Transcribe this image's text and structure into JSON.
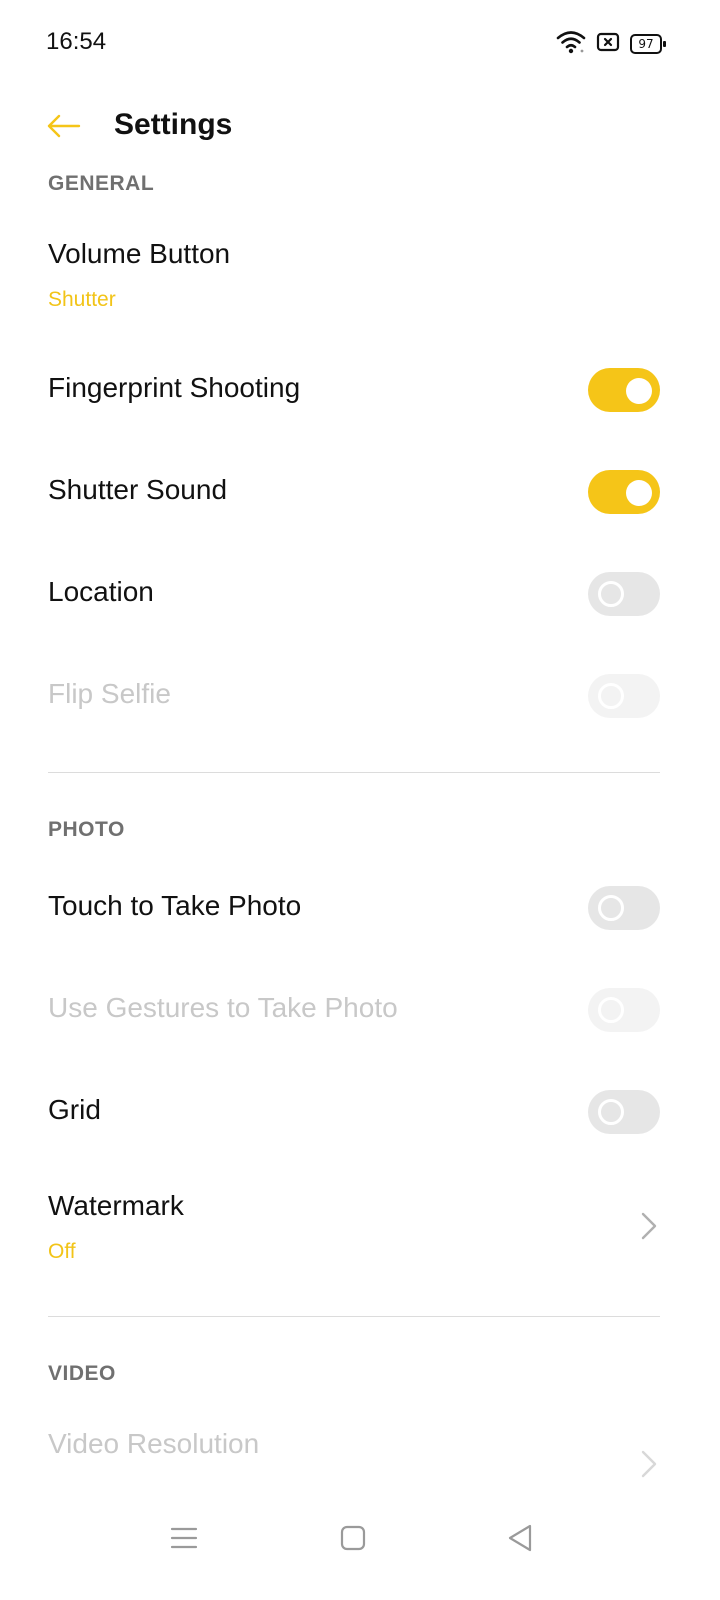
{
  "status_bar": {
    "time": "16:54",
    "battery": "97",
    "icons": [
      "wifi-icon",
      "sim-blocked-icon",
      "battery-icon"
    ]
  },
  "header": {
    "title": "Settings",
    "back_icon": "arrow-left-icon"
  },
  "colors": {
    "accent": "#f5c518",
    "subtitle_accent": "#f2c418",
    "toggle_off": "#e6e6e6",
    "disabled_text": "#c8c8c8"
  },
  "sections": {
    "general": {
      "header": "GENERAL",
      "volume_button": {
        "title": "Volume Button",
        "value": "Shutter"
      },
      "fingerprint_shooting": {
        "title": "Fingerprint Shooting",
        "state": "on"
      },
      "shutter_sound": {
        "title": "Shutter Sound",
        "state": "on"
      },
      "location": {
        "title": "Location",
        "state": "off"
      },
      "flip_selfie": {
        "title": "Flip Selfie",
        "state": "disabled"
      }
    },
    "photo": {
      "header": "PHOTO",
      "touch_to_take_photo": {
        "title": "Touch to Take Photo",
        "state": "off"
      },
      "use_gestures": {
        "title": "Use Gestures to Take Photo",
        "state": "disabled"
      },
      "grid": {
        "title": "Grid",
        "state": "off"
      },
      "watermark": {
        "title": "Watermark",
        "value": "Off"
      }
    },
    "video": {
      "header": "VIDEO",
      "video_resolution": {
        "title": "Video Resolution"
      }
    }
  },
  "nav_bar": {
    "icons": [
      "menu-icon",
      "home-square-icon",
      "back-triangle-icon"
    ]
  }
}
